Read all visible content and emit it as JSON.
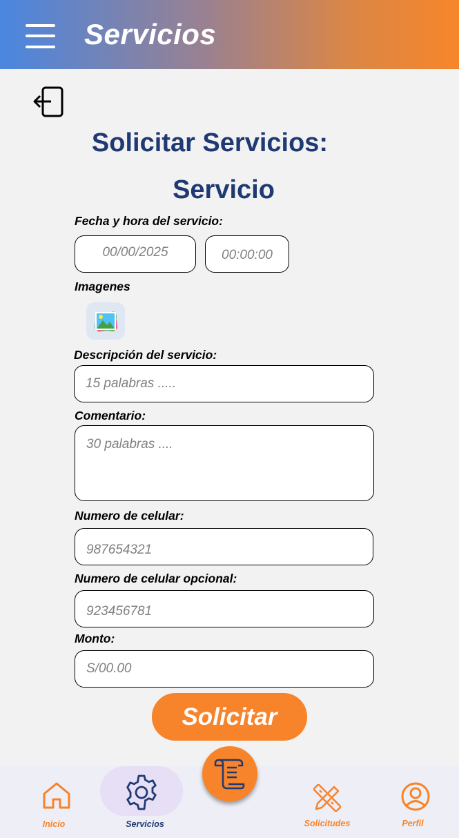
{
  "header": {
    "title": "Servicios",
    "menu_icon": "hamburger-menu-icon"
  },
  "back_icon": "logout-arrow-icon",
  "page": {
    "title": "Solicitar Servicios:",
    "subtitle": "Servicio"
  },
  "form": {
    "date_time_label": "Fecha y hora del servicio:",
    "date_placeholder": "00/00/2025",
    "time_placeholder": "00:00:00",
    "images_label": "Imagenes",
    "image_icon": "image-gallery-icon",
    "description_label": "Descripción del servicio:",
    "description_placeholder": "15 palabras .....",
    "comment_label": "Comentario:",
    "comment_placeholder": "30 palabras ....",
    "phone_label": "Numero de celular:",
    "phone_placeholder": "987654321",
    "phone_opt_label": "Numero de celular opcional:",
    "phone_opt_placeholder": "923456781",
    "amount_label": "Monto:",
    "amount_placeholder": "S/00.00",
    "submit_label": "Solicitar"
  },
  "nav": {
    "items": [
      {
        "label": "Inicio",
        "icon": "home-icon"
      },
      {
        "label": "Servicios",
        "icon": "gear-icon",
        "active": true
      },
      {
        "label": "Solicitudes",
        "icon": "ruler-pencil-icon"
      },
      {
        "label": "Perfil",
        "icon": "user-circle-icon"
      }
    ],
    "fab_icon": "scroll-document-icon"
  },
  "colors": {
    "accent": "#f7832a",
    "title": "#1f3a73",
    "active_nav_text": "#1f3a73",
    "active_pill": "#e6dff5"
  }
}
